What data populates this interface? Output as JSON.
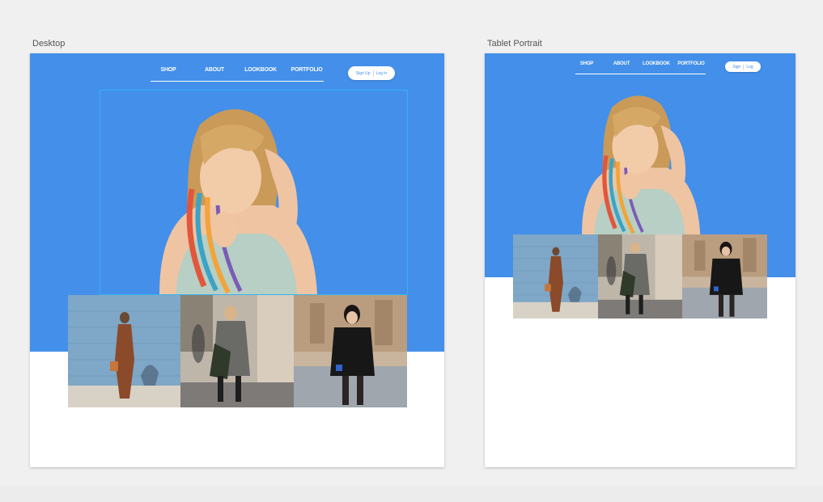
{
  "canvas": {
    "background": "#f0f0f0"
  },
  "artboards": {
    "desktop": {
      "label": "Desktop",
      "nav": {
        "links": [
          "SHOP",
          "ABOUT",
          "LOOKBOOK",
          "PORTFOLIO"
        ],
        "signup_label": "Sign Up",
        "login_label": "Log in"
      }
    },
    "tablet": {
      "label": "Tablet Portrait",
      "nav": {
        "links": [
          "SHOP",
          "ABOUT",
          "LOOKBOOK",
          "PORTFOLIO"
        ],
        "signup_label": "Sign",
        "login_label": "Log"
      }
    }
  },
  "colors": {
    "hero_blue": "#438fea",
    "selection_outline": "#34b4f0",
    "button_text": "#438fea",
    "page_white": "#ffffff"
  },
  "images": {
    "hero": "model-portrait-rainbow-hair",
    "gallery": [
      "woman-rust-dress-blue-wall",
      "woman-camo-coat-street",
      "woman-leather-jacket-street"
    ]
  }
}
